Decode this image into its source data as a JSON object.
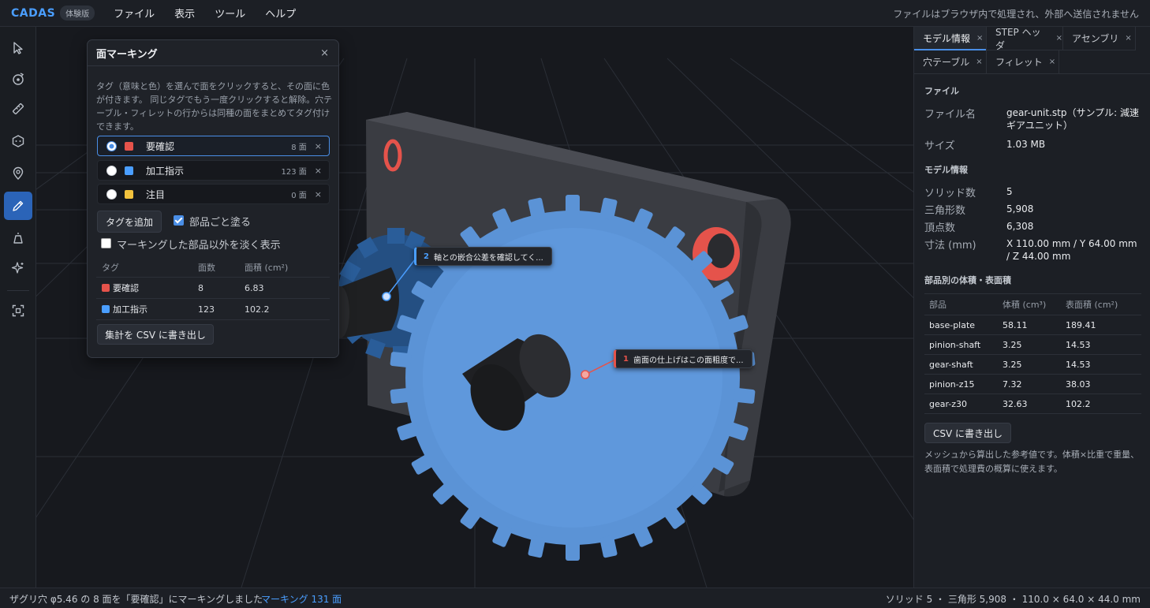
{
  "app": {
    "logo": "CADAS",
    "badge": "体験版"
  },
  "menu": [
    "ファイル",
    "表示",
    "ツール",
    "ヘルプ"
  ],
  "top_notice": "ファイルはブラウザ内で処理され、外部へ送信されません",
  "toolbar": [
    "select-icon",
    "orbit-icon",
    "ruler-icon",
    "section-icon",
    "pin-icon",
    "marker-icon",
    "draft-icon",
    "sparkle-icon",
    "fit-view-icon"
  ],
  "panel": {
    "title": "面マーキング",
    "close": "×",
    "description": "タグ（意味と色）を選んで面をクリックすると、その面に色が付きます。 同じタグでもう一度クリックすると解除。穴テーブル・フィレットの行からは同種の面をまとめてタグ付けできます。",
    "tags": [
      {
        "name": "要確認",
        "count": "8 面",
        "color": "#e5534b",
        "selected": true
      },
      {
        "name": "加工指示",
        "count": "123 面",
        "color": "#4a9eff",
        "selected": false
      },
      {
        "name": "注目",
        "count": "0 面",
        "color": "#f2c23d",
        "selected": false
      }
    ],
    "remove_label": "×",
    "add_tag_button": "タグを追加",
    "paint_by_part_label": "部品ごと塗る",
    "fade_others_label": "マーキングした部品以外を淡く表示",
    "table_headers": [
      "タグ",
      "面数",
      "面積 (cm²)"
    ],
    "table_rows": [
      {
        "tag": "要確認",
        "color": "#e5534b",
        "faces": "8",
        "area": "6.83"
      },
      {
        "tag": "加工指示",
        "color": "#4a9eff",
        "faces": "123",
        "area": "102.2"
      }
    ],
    "export_button": "集計を CSV に書き出し"
  },
  "callouts": [
    {
      "num": "2",
      "text": "軸との嵌合公差を確認してく...",
      "color": "#4a9eff"
    },
    {
      "num": "1",
      "text": "歯面の仕上げはこの面粗度で...",
      "color": "#e5534b"
    }
  ],
  "right_panel": {
    "tabs": [
      {
        "label": "モデル情報",
        "active": true
      },
      {
        "label": "STEP ヘッダ",
        "active": false
      },
      {
        "label": "アセンブリ",
        "active": false
      },
      {
        "label": "穴テーブル",
        "active": false
      },
      {
        "label": "フィレット",
        "active": false
      }
    ],
    "tab_close": "×",
    "file_section": "ファイル",
    "file_name_label": "ファイル名",
    "file_name_value": "gear-unit.stp（サンプル: 減速ギアユニット）",
    "size_label": "サイズ",
    "size_value": "1.03 MB",
    "model_section": "モデル情報",
    "solids_label": "ソリッド数",
    "solids_value": "5",
    "triangles_label": "三角形数",
    "triangles_value": "5,908",
    "vertices_label": "頂点数",
    "vertices_value": "6,308",
    "dims_label": "寸法 (mm)",
    "dims_value": "X 110.00 mm / Y 64.00 mm / Z 44.00 mm",
    "parts_section": "部品別の体積・表面積",
    "parts_headers": [
      "部品",
      "体積 (cm³)",
      "表面積 (cm²)"
    ],
    "parts": [
      {
        "name": "base-plate",
        "volume": "58.11",
        "area": "189.41"
      },
      {
        "name": "pinion-shaft",
        "volume": "3.25",
        "area": "14.53"
      },
      {
        "name": "gear-shaft",
        "volume": "3.25",
        "area": "14.53"
      },
      {
        "name": "pinion-z15",
        "volume": "7.32",
        "area": "38.03"
      },
      {
        "name": "gear-z30",
        "volume": "32.63",
        "area": "102.2"
      }
    ],
    "csv_button": "CSV に書き出し",
    "note": "メッシュから算出した参考値です。体積×比重で重量、表面積で処理費の概算に使えます。"
  },
  "status": {
    "left": "ザグリ穴 φ5.46 の 8 面を「要確認」にマーキングしました",
    "marking": "マーキング 131 面",
    "right": "ソリッド 5 ・ 三角形 5,908 ・ 110.0 × 64.0 × 44.0 mm"
  }
}
